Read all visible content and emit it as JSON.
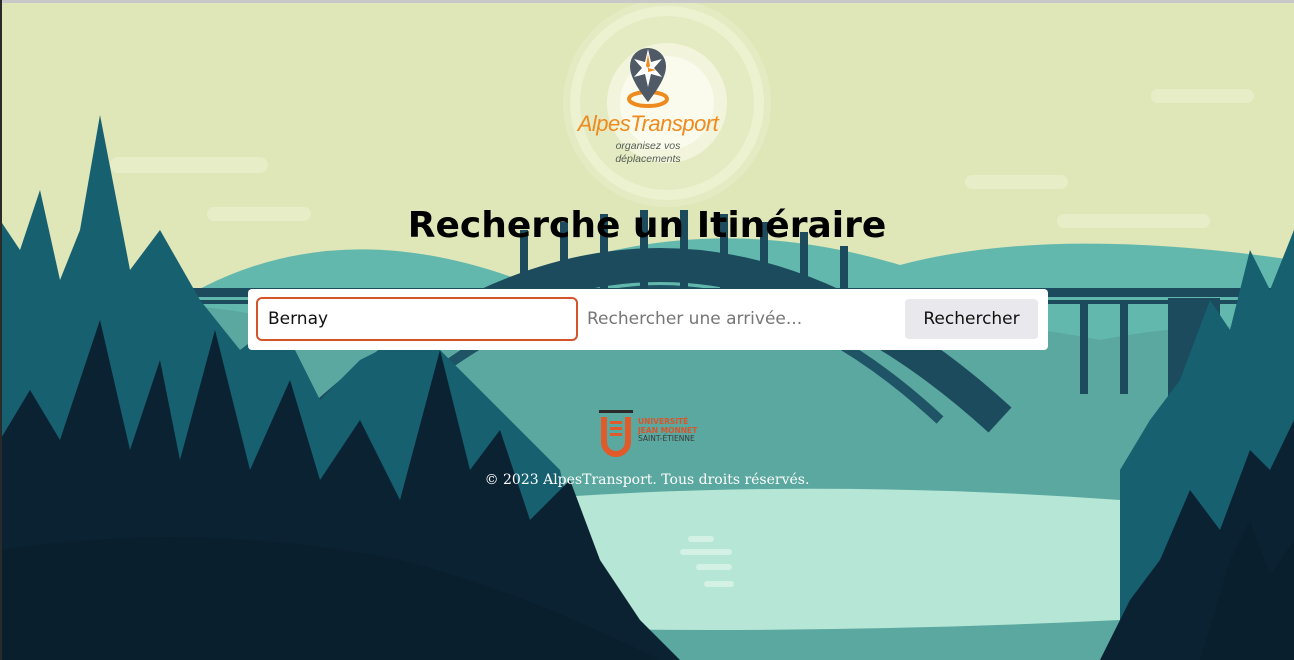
{
  "brand": {
    "name": "AlpesTransport",
    "tagline_line1": "organisez vos",
    "tagline_line2": "déplacements",
    "logo_icon": "compass-pin-icon"
  },
  "page": {
    "title": "Recherche un Itinéraire"
  },
  "search": {
    "departure_value": "Bernay",
    "departure_placeholder": "",
    "arrival_value": "",
    "arrival_placeholder": "Rechercher une arrivée...",
    "button_label": "Rechercher"
  },
  "partner": {
    "line1": "UNIVERSITÉ",
    "line2": "JEAN MONNET",
    "line3": "SAINT-ÉTIENNE",
    "logo_icon": "ujm-logo-icon"
  },
  "footer": {
    "copyright": "© 2023 AlpesTransport. Tous droits réservés."
  },
  "colors": {
    "sky": "#dfe6b8",
    "accent_orange": "#ef8a1f",
    "focus_border": "#d4552a",
    "forest_dark": "#0b2233",
    "forest_teal": "#166070",
    "water": "#b5e6d6"
  }
}
